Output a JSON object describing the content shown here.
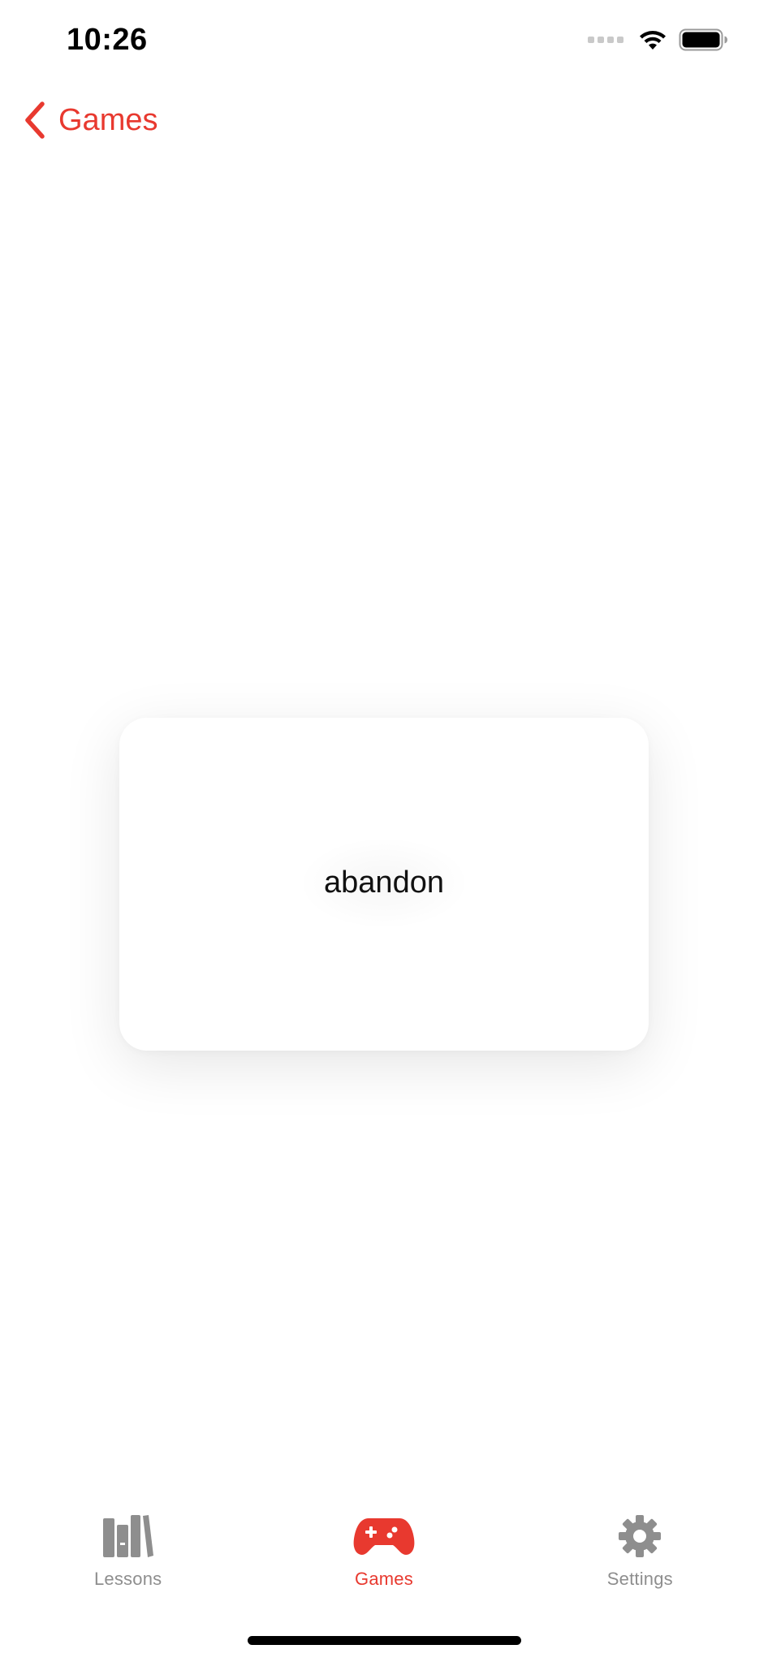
{
  "status_bar": {
    "time": "10:26"
  },
  "nav": {
    "back_label": "Games",
    "back_icon": "chevron-left-icon"
  },
  "card": {
    "word": "abandon"
  },
  "tab_bar": {
    "tabs": [
      {
        "label": "Lessons",
        "icon": "books-icon",
        "active": false
      },
      {
        "label": "Games",
        "icon": "gamecontroller-icon",
        "active": true
      },
      {
        "label": "Settings",
        "icon": "gear-icon",
        "active": false
      }
    ]
  },
  "colors": {
    "accent": "#e8392f",
    "inactive": "#8e8e8e",
    "background": "#ffffff"
  }
}
